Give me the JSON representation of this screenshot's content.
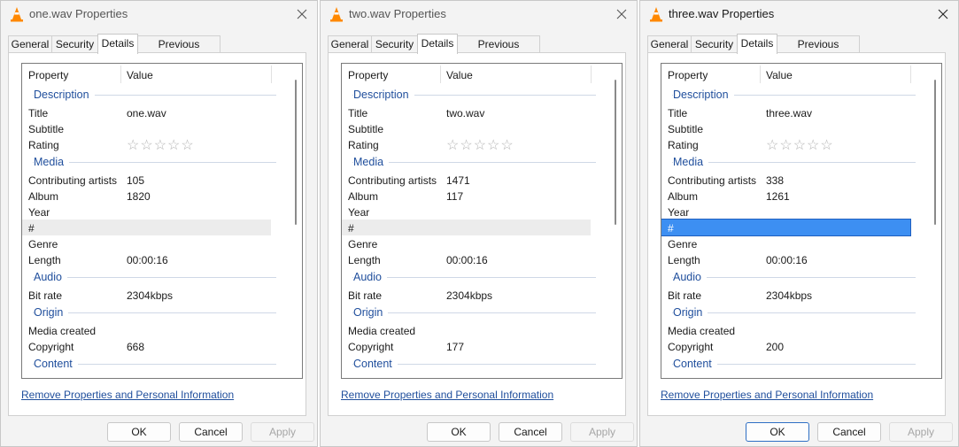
{
  "colors": {
    "accent": "#1f4e9c",
    "selection": "#3d8ff2",
    "hover_row": "#ececec",
    "vlc_orange": "#ff8800"
  },
  "dialogs": [
    {
      "title": "one.wav Properties",
      "tabs": [
        {
          "label": "General"
        },
        {
          "label": "Security"
        },
        {
          "label": "Details",
          "active": true
        },
        {
          "label": "Previous Versions"
        }
      ],
      "columns": {
        "property": "Property",
        "value": "Value"
      },
      "rows": [
        {
          "section": "Description"
        },
        {
          "prop": "Title",
          "value": "one.wav"
        },
        {
          "prop": "Subtitle",
          "value": ""
        },
        {
          "prop": "Rating",
          "stars": "☆☆☆☆☆"
        },
        {
          "section": "Media"
        },
        {
          "prop": "Contributing artists",
          "value": "105"
        },
        {
          "prop": "Album",
          "value": "1820"
        },
        {
          "prop": "Year",
          "value": ""
        },
        {
          "prop": "#",
          "value": "",
          "highlight": "gray"
        },
        {
          "prop": "Genre",
          "value": ""
        },
        {
          "prop": "Length",
          "value": "00:00:16"
        },
        {
          "section": "Audio"
        },
        {
          "prop": "Bit rate",
          "value": "2304kbps"
        },
        {
          "section": "Origin"
        },
        {
          "prop": "Media created",
          "value": ""
        },
        {
          "prop": "Copyright",
          "value": "668"
        },
        {
          "section": "Content"
        }
      ],
      "remove_link": "Remove Properties and Personal Information",
      "buttons": {
        "ok": "OK",
        "cancel": "Cancel",
        "apply": "Apply"
      }
    },
    {
      "title": "two.wav Properties",
      "tabs": [
        {
          "label": "General"
        },
        {
          "label": "Security"
        },
        {
          "label": "Details",
          "active": true
        },
        {
          "label": "Previous Versions"
        }
      ],
      "columns": {
        "property": "Property",
        "value": "Value"
      },
      "rows": [
        {
          "section": "Description"
        },
        {
          "prop": "Title",
          "value": "two.wav"
        },
        {
          "prop": "Subtitle",
          "value": ""
        },
        {
          "prop": "Rating",
          "stars": "☆☆☆☆☆"
        },
        {
          "section": "Media"
        },
        {
          "prop": "Contributing artists",
          "value": "1471"
        },
        {
          "prop": "Album",
          "value": "117"
        },
        {
          "prop": "Year",
          "value": ""
        },
        {
          "prop": "#",
          "value": "",
          "highlight": "gray"
        },
        {
          "prop": "Genre",
          "value": ""
        },
        {
          "prop": "Length",
          "value": "00:00:16"
        },
        {
          "section": "Audio"
        },
        {
          "prop": "Bit rate",
          "value": "2304kbps"
        },
        {
          "section": "Origin"
        },
        {
          "prop": "Media created",
          "value": ""
        },
        {
          "prop": "Copyright",
          "value": "177"
        },
        {
          "section": "Content"
        }
      ],
      "remove_link": "Remove Properties and Personal Information",
      "buttons": {
        "ok": "OK",
        "cancel": "Cancel",
        "apply": "Apply"
      }
    },
    {
      "title": "three.wav Properties",
      "tabs": [
        {
          "label": "General"
        },
        {
          "label": "Security"
        },
        {
          "label": "Details",
          "active": true
        },
        {
          "label": "Previous Versions"
        }
      ],
      "columns": {
        "property": "Property",
        "value": "Value"
      },
      "rows": [
        {
          "section": "Description"
        },
        {
          "prop": "Title",
          "value": "three.wav"
        },
        {
          "prop": "Subtitle",
          "value": ""
        },
        {
          "prop": "Rating",
          "stars": "☆☆☆☆☆"
        },
        {
          "section": "Media"
        },
        {
          "prop": "Contributing artists",
          "value": "338"
        },
        {
          "prop": "Album",
          "value": "1261"
        },
        {
          "prop": "Year",
          "value": ""
        },
        {
          "prop": "#",
          "value": "",
          "highlight": "blue"
        },
        {
          "prop": "Genre",
          "value": ""
        },
        {
          "prop": "Length",
          "value": "00:00:16"
        },
        {
          "section": "Audio"
        },
        {
          "prop": "Bit rate",
          "value": "2304kbps"
        },
        {
          "section": "Origin"
        },
        {
          "prop": "Media created",
          "value": ""
        },
        {
          "prop": "Copyright",
          "value": "200"
        },
        {
          "section": "Content"
        }
      ],
      "remove_link": "Remove Properties and Personal Information",
      "buttons": {
        "ok": "OK",
        "cancel": "Cancel",
        "apply": "Apply"
      }
    }
  ]
}
